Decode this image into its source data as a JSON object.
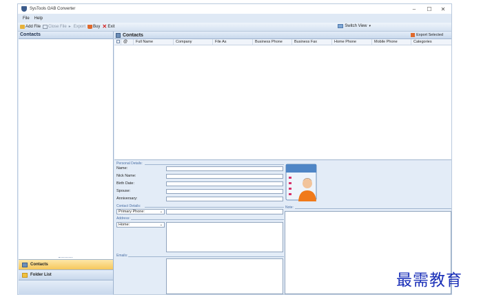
{
  "window": {
    "title": "SysTools OAB Converter",
    "controls": {
      "minimize": "–",
      "maximize": "☐",
      "close": "✕"
    }
  },
  "menu": [
    "File",
    "Help"
  ],
  "toolbar": {
    "add_file": "Add File",
    "close_file": "Close File",
    "export": "Export",
    "buy": "Buy",
    "exit": "Exit",
    "switch_view": "Switch View"
  },
  "left_pane": {
    "header": "Contacts",
    "nav": {
      "contacts": "Contacts",
      "folder_list": "Folder List"
    }
  },
  "contacts_pane": {
    "header": "Contacts",
    "export_selected": "Export Selected",
    "columns": [
      "Full Name",
      "Company",
      "File As",
      "Business Phone",
      "Business Fax",
      "Home Phone",
      "Mobile Phone",
      "Categories"
    ]
  },
  "details": {
    "personal_section": "Personal Details:",
    "name": "Name:",
    "nick_name": "Nick Name:",
    "birth_date": "Birth Date:",
    "spouse": "Spouse:",
    "anniversary": "Anniversary:",
    "contact_section": "Contact Details:",
    "phone_type": "Primary Phone:",
    "address_section": "Address:",
    "address_type": "Home:",
    "emails": "Emails:",
    "note": "Note:"
  },
  "watermark": "最需教育"
}
